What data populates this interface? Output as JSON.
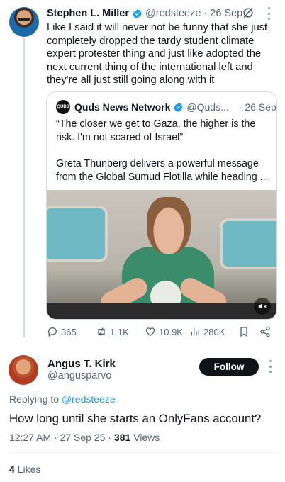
{
  "tweet": {
    "author_name": "Stephen L. Miller",
    "author_handle": "@redsteeze",
    "time": "26 Sep",
    "separator": "·",
    "text": "Like I said it will never not be funny that she just completely dropped the tardy student climate expert protester thing and just like adopted the next current thing of the international left and they're all just still going along with it",
    "quote": {
      "avatar_text": "QUDS",
      "author_name": "Quds News Network",
      "author_handle": "@Quds...",
      "time": "26 Sep",
      "text": "“The closer we get to Gaza, the higher is the risk. I'm not scared of Israel”",
      "description": "Greta Thunberg delivers a powerful message from the Global Sumud Flotilla while heading ..."
    },
    "stats": {
      "replies": "365",
      "retweets": "1.1K",
      "likes": "10.9K",
      "views": "280K"
    }
  },
  "reply": {
    "author_name": "Angus T. Kirk",
    "author_handle": "@angusparvo",
    "follow_label": "Follow",
    "replying_to_label": "Replying to",
    "replying_to_handle": "@redsteeze",
    "text": "How long until she starts an OnlyFans account?",
    "timestamp": "12:27 AM · 27 Sep 25 · ",
    "views_count": "381",
    "views_label": " Views",
    "likes_count": "4",
    "likes_label": " Likes"
  },
  "colors": {
    "accent": "#1d9bf0",
    "text": "#0f1419",
    "muted": "#536471",
    "border": "#cfd9de"
  },
  "icons": [
    "verified-badge-icon",
    "grok-icon",
    "more-icon",
    "reply-icon",
    "retweet-icon",
    "like-icon",
    "views-icon",
    "bookmark-icon",
    "share-icon",
    "mute-icon"
  ]
}
